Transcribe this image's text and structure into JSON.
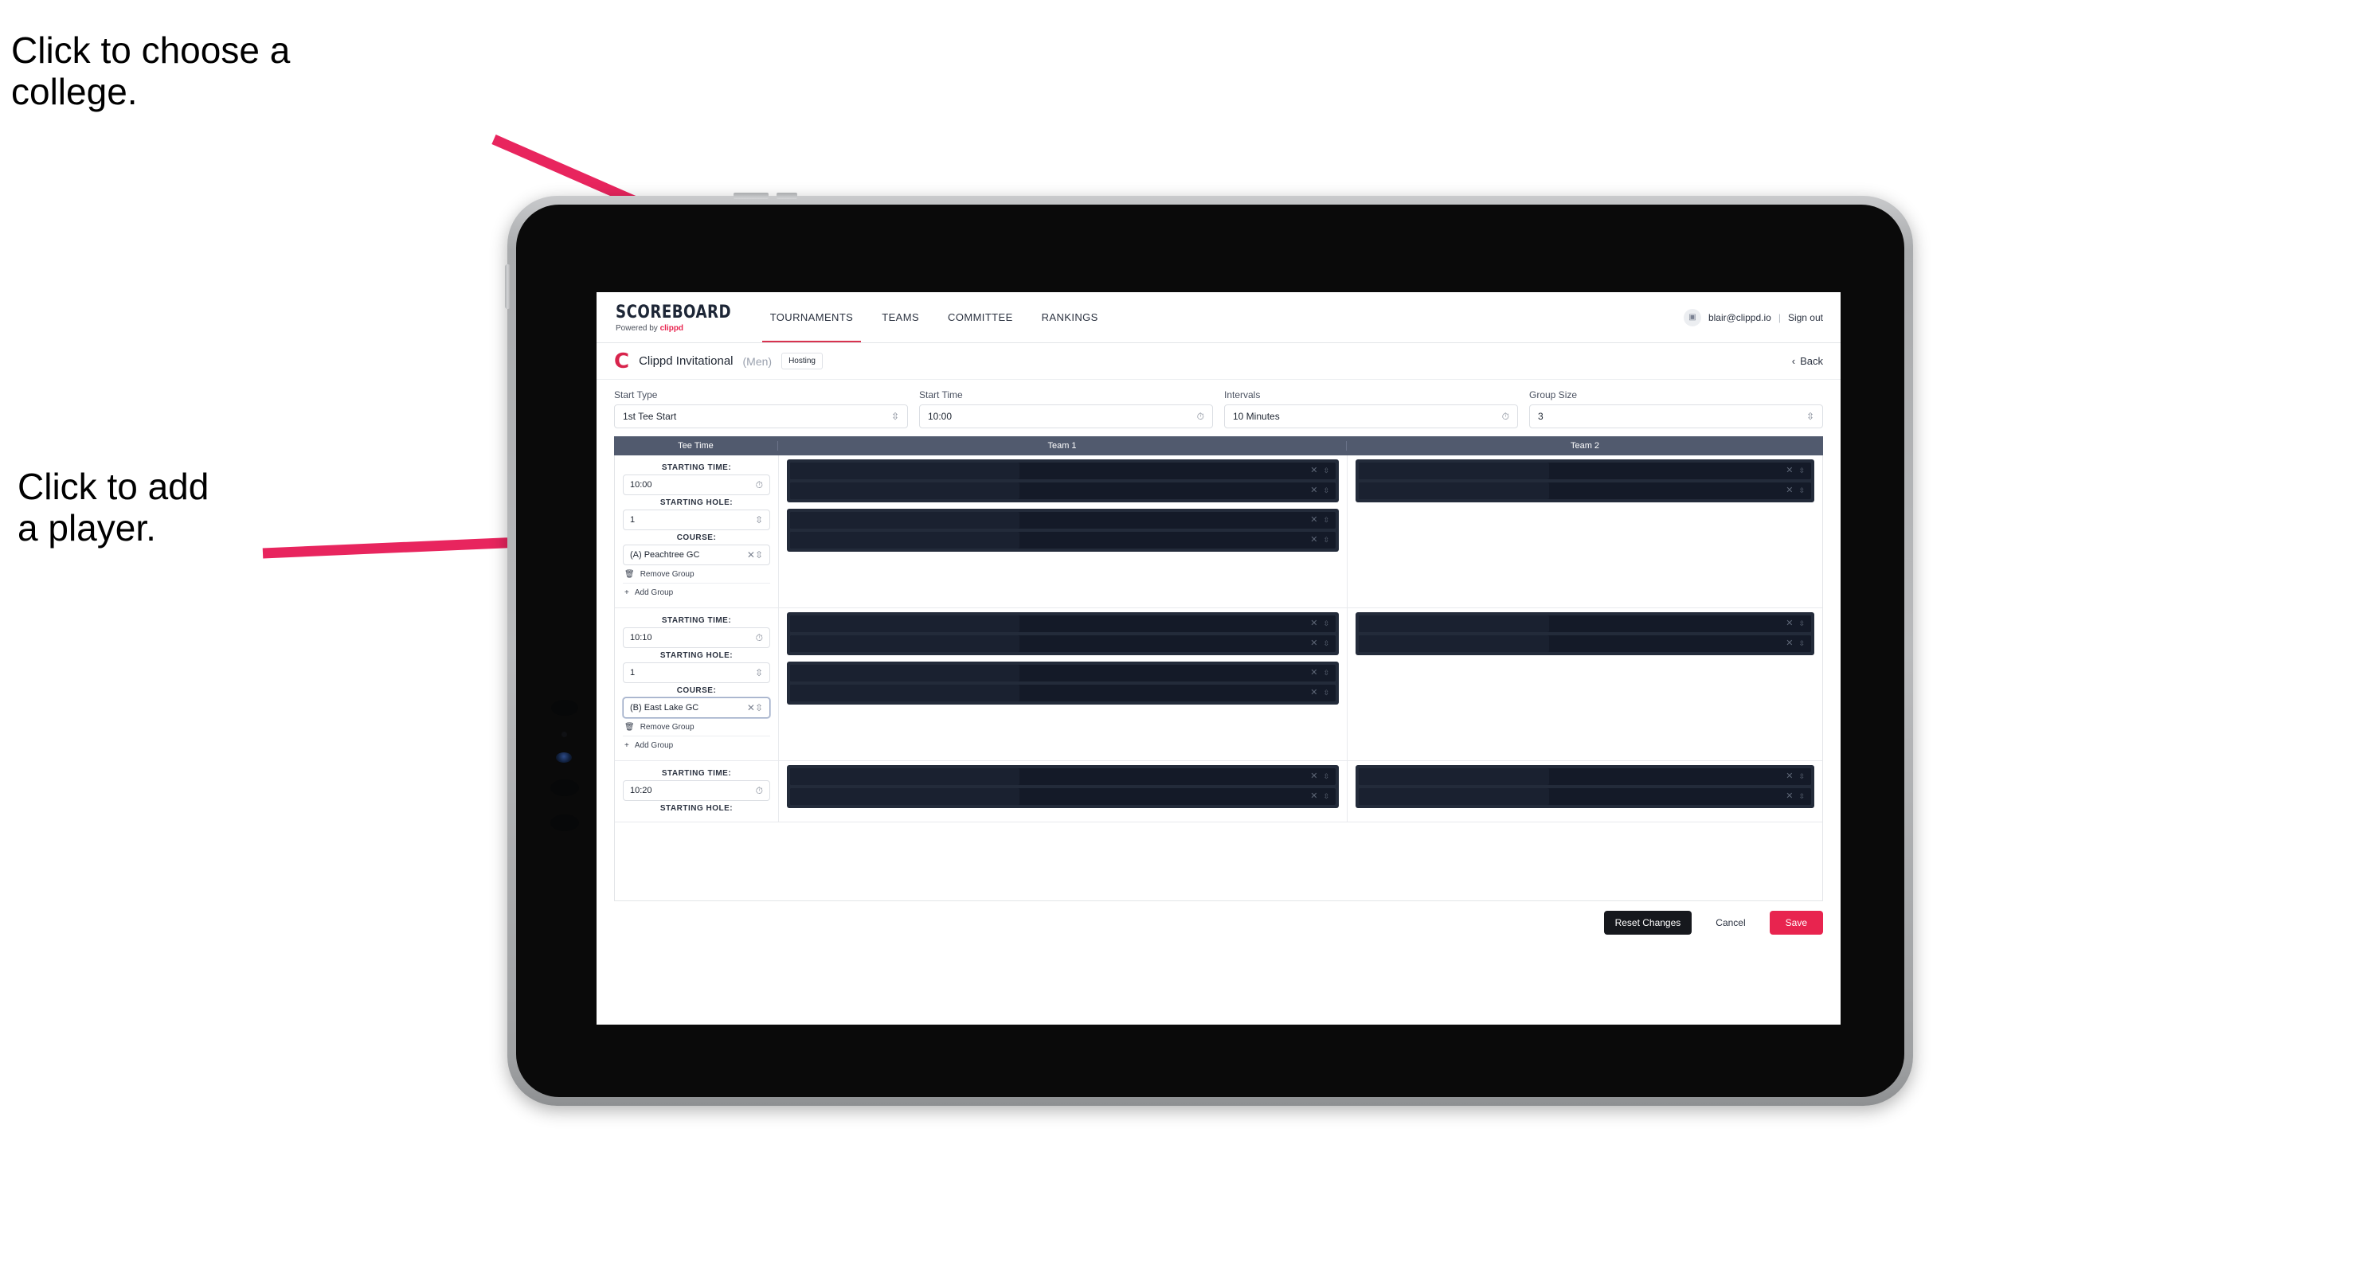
{
  "annotations": {
    "college": "Click to choose a\ncollege.",
    "player": "Click to add\na player."
  },
  "colors": {
    "accent_pink": "#e8244f",
    "arrow_pink": "#e8255e",
    "header_row": "#515a6e",
    "dark_block": "#232b3a",
    "dark_row": "#141a28"
  },
  "app": {
    "brand": {
      "name": "SCOREBOARD",
      "sub_prefix": "Powered by ",
      "sub_brand": "clippd"
    },
    "nav": [
      {
        "label": "TOURNAMENTS",
        "active": true
      },
      {
        "label": "TEAMS",
        "active": false
      },
      {
        "label": "COMMITTEE",
        "active": false
      },
      {
        "label": "RANKINGS",
        "active": false
      }
    ],
    "account": {
      "avatar_icon": "image-icon",
      "email": "blair@clippd.io",
      "separator": "|",
      "sign_out": "Sign out"
    },
    "title": {
      "logo": "C",
      "tournament": "Clippd Invitational",
      "gender": "(Men)",
      "badge": "Hosting",
      "back_label": "Back",
      "back_icon": "chevron-left-icon"
    },
    "filters": [
      {
        "label": "Start Type",
        "value": "1st Tee Start",
        "icon": "stepper-icon"
      },
      {
        "label": "Start Time",
        "value": "10:00",
        "icon": "clock-icon"
      },
      {
        "label": "Intervals",
        "value": "10 Minutes",
        "icon": "clock-icon"
      },
      {
        "label": "Group Size",
        "value": "3",
        "icon": "stepper-icon"
      }
    ],
    "table": {
      "headers": {
        "tee_time": "Tee Time",
        "team1": "Team 1",
        "team2": "Team 2"
      },
      "field_labels": {
        "time": "STARTING TIME:",
        "hole": "STARTING HOLE:",
        "course": "COURSE:"
      },
      "actions": {
        "remove": "Remove Group",
        "add": "Add Group",
        "remove_icon": "trash-icon",
        "add_icon": "plus-icon"
      },
      "row_icons": {
        "clear": "clear-x-icon",
        "stepper": "stepper-chevron-icon"
      },
      "rows": [
        {
          "starting_time": "10:00",
          "starting_hole": "1",
          "course": "(A) Peachtree GC",
          "course_focused": false,
          "team1_blocks": [
            {
              "players": 2
            },
            {
              "players": 2
            }
          ],
          "team2_blocks": [
            {
              "players": 2
            }
          ]
        },
        {
          "starting_time": "10:10",
          "starting_hole": "1",
          "course": "(B) East Lake GC",
          "course_focused": true,
          "team1_blocks": [
            {
              "players": 2
            },
            {
              "players": 2
            }
          ],
          "team2_blocks": [
            {
              "players": 2
            }
          ]
        },
        {
          "starting_time": "10:20",
          "starting_hole": "",
          "course": "",
          "course_focused": false,
          "team1_blocks": [
            {
              "players": 2
            }
          ],
          "team2_blocks": [
            {
              "players": 2
            }
          ]
        }
      ]
    },
    "footer": {
      "reset": "Reset Changes",
      "cancel": "Cancel",
      "save": "Save"
    }
  }
}
